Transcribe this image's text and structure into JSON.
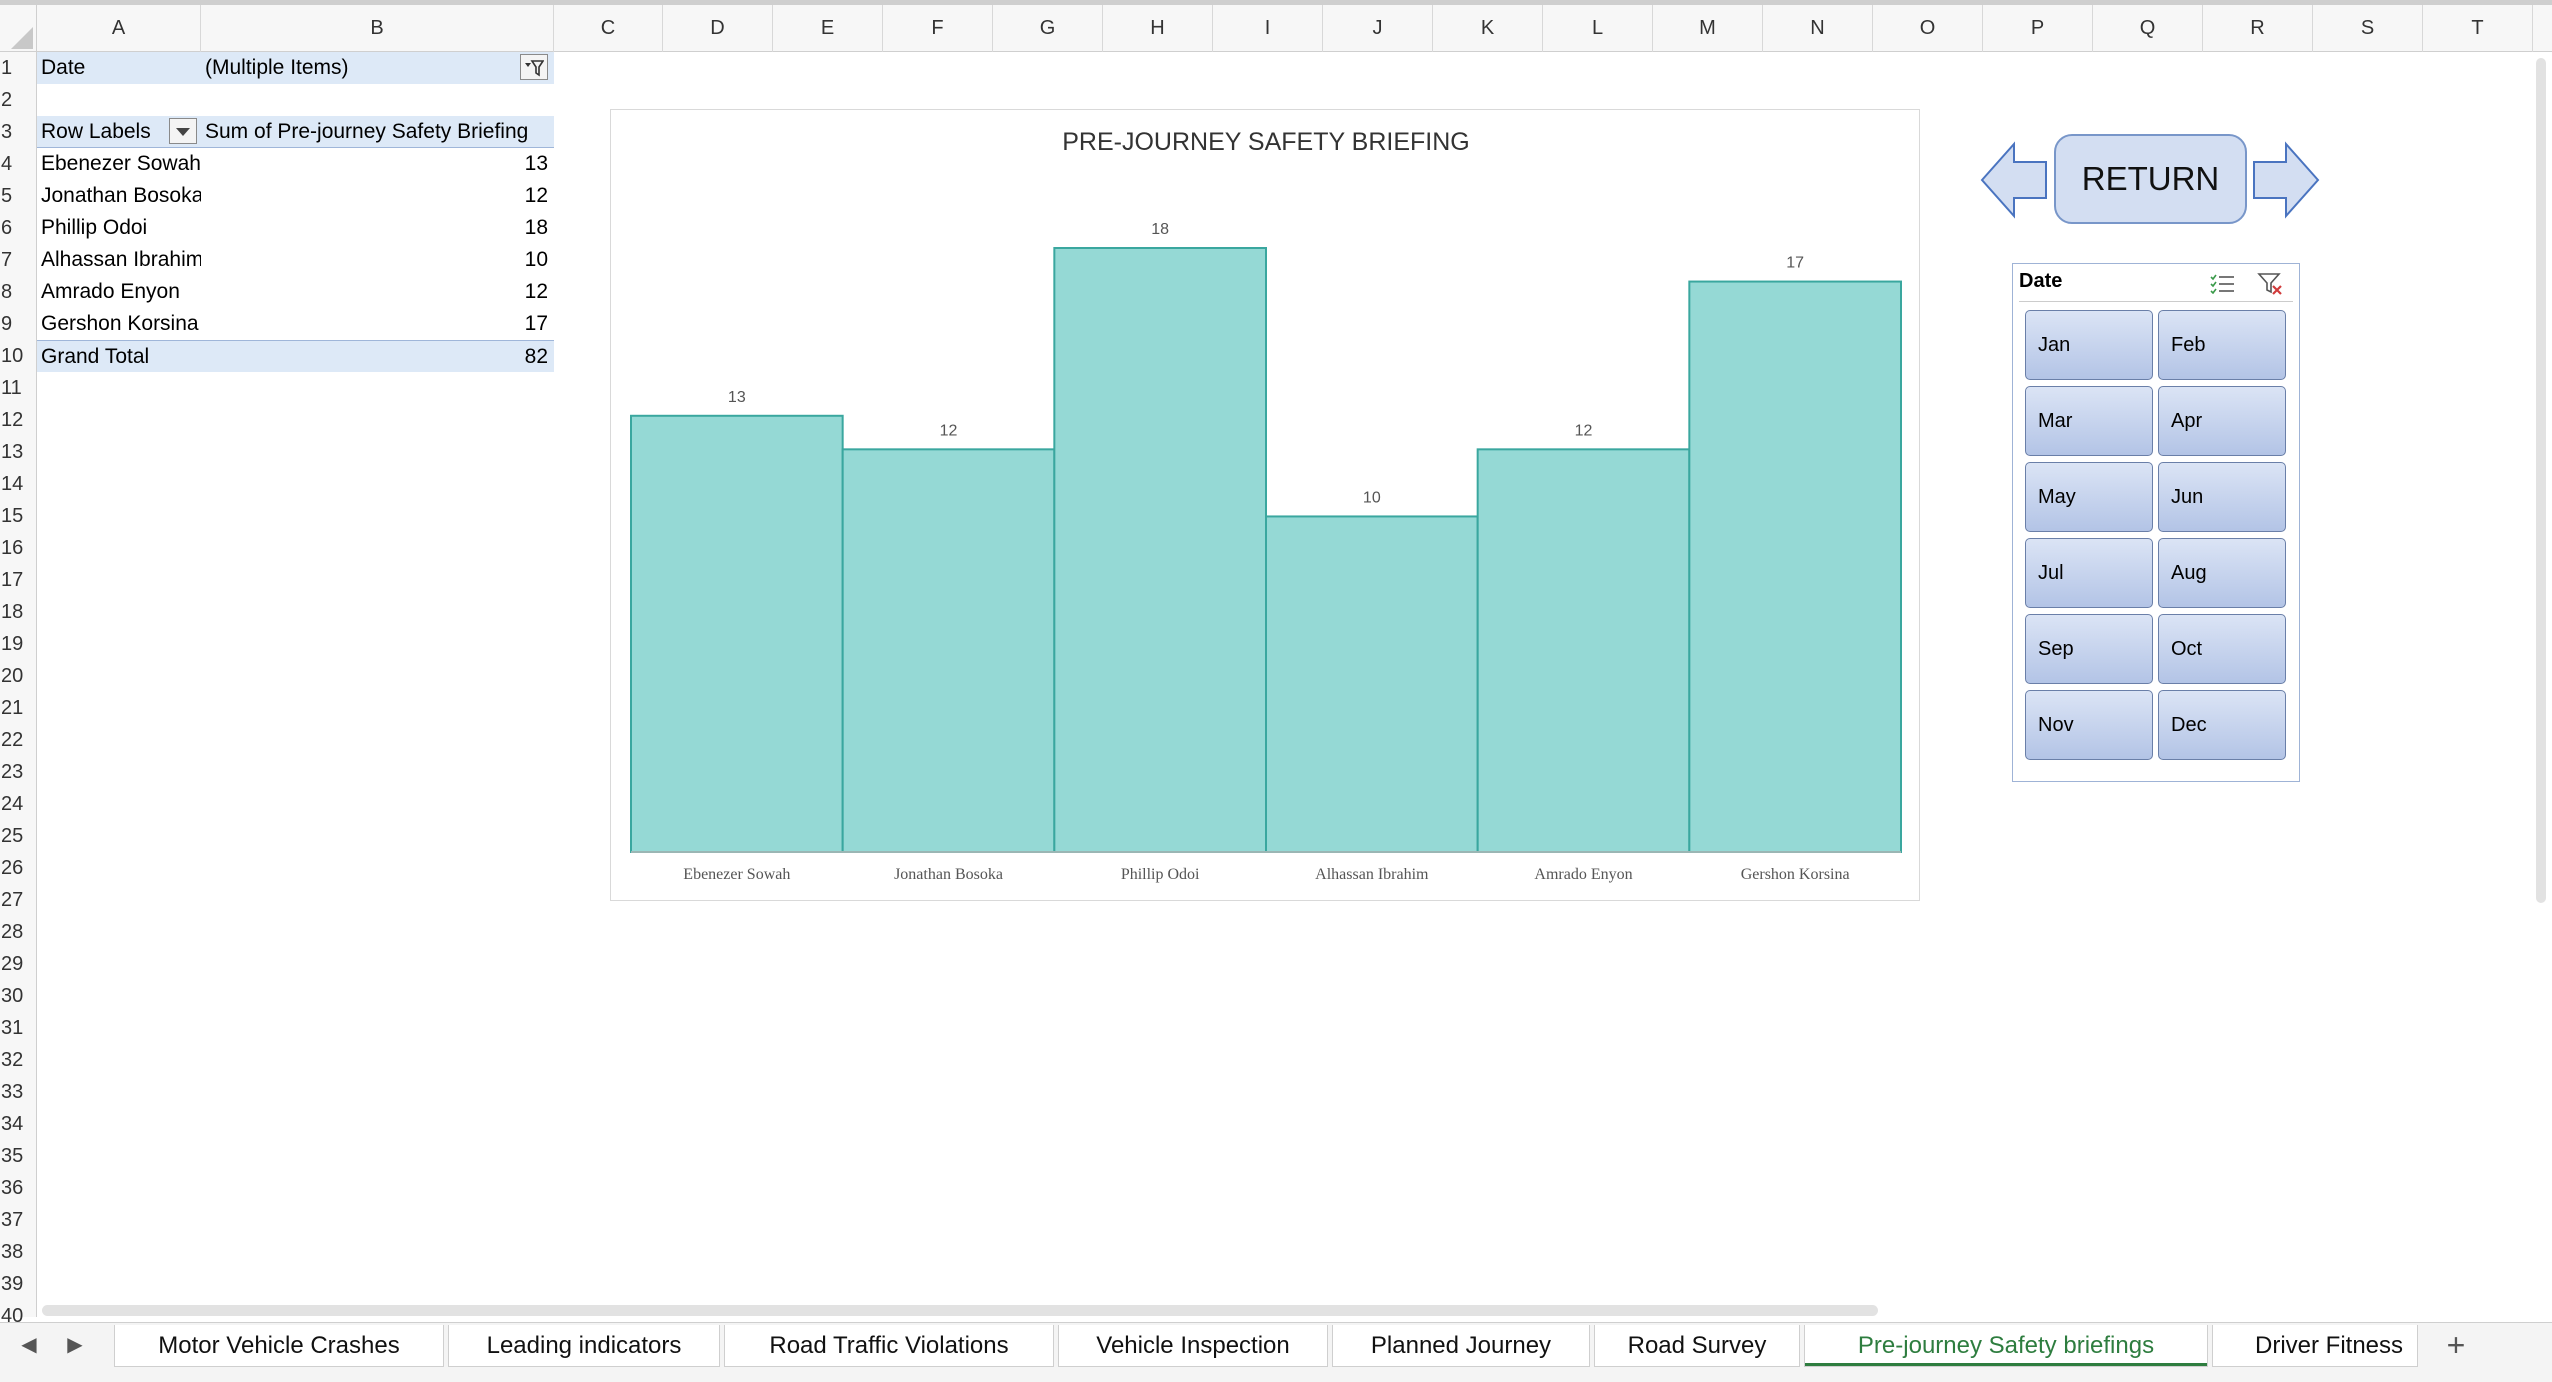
{
  "columns": [
    "A",
    "B",
    "C",
    "D",
    "E",
    "F",
    "G",
    "H",
    "I",
    "J",
    "K",
    "L",
    "M",
    "N",
    "O",
    "P",
    "Q",
    "R",
    "S",
    "T"
  ],
  "rows": [
    "1",
    "2",
    "3",
    "4",
    "5",
    "6",
    "7",
    "8",
    "9",
    "10",
    "11",
    "12",
    "13",
    "14",
    "15",
    "16",
    "17",
    "18",
    "19",
    "20",
    "21",
    "22",
    "23",
    "24",
    "25",
    "26",
    "27",
    "28",
    "29",
    "30",
    "31",
    "32",
    "33",
    "34",
    "35",
    "36",
    "37",
    "38",
    "39",
    "40"
  ],
  "pivot": {
    "filter_label": "Date",
    "filter_value": "(Multiple Items)",
    "row_labels_header": "Row Labels",
    "value_header": "Sum of Pre-journey Safety Briefing",
    "rows": [
      {
        "name": "Ebenezer Sowah",
        "value": "13"
      },
      {
        "name": "Jonathan Bosoka",
        "value": "12"
      },
      {
        "name": "Phillip Odoi",
        "value": "18"
      },
      {
        "name": "Alhassan Ibrahim",
        "value": "10"
      },
      {
        "name": "Amrado Enyon",
        "value": "12"
      },
      {
        "name": "Gershon Korsina",
        "value": "17"
      }
    ],
    "grand_total_label": "Grand Total",
    "grand_total_value": "82"
  },
  "chart_data": {
    "type": "bar",
    "title": "PRE-JOURNEY SAFETY BRIEFING",
    "categories": [
      "Ebenezer Sowah",
      "Jonathan Bosoka",
      "Phillip Odoi",
      "Alhassan Ibrahim",
      "Amrado Enyon",
      "Gershon Korsina"
    ],
    "values": [
      13,
      12,
      18,
      10,
      12,
      17
    ],
    "data_labels": true,
    "ylim": [
      0,
      18
    ],
    "grid": false,
    "legend": "none",
    "bar_color": "#95d9d5",
    "bar_border_color": "#3aa79f"
  },
  "return_button": {
    "label": "RETURN"
  },
  "slicer": {
    "title": "Date",
    "months": [
      "Jan",
      "Feb",
      "Mar",
      "Apr",
      "May",
      "Jun",
      "Jul",
      "Aug",
      "Sep",
      "Oct",
      "Nov",
      "Dec"
    ]
  },
  "sheet_tabs": {
    "tabs": [
      "Motor Vehicle Crashes",
      "Leading indicators",
      "Road Traffic Violations",
      "Vehicle Inspection",
      "Planned Journey",
      "Road Survey",
      "Pre-journey Safety briefings",
      "Driver Fitness"
    ],
    "active": "Pre-journey Safety briefings",
    "active_color": "#2e7d3f",
    "add_label": "+"
  }
}
